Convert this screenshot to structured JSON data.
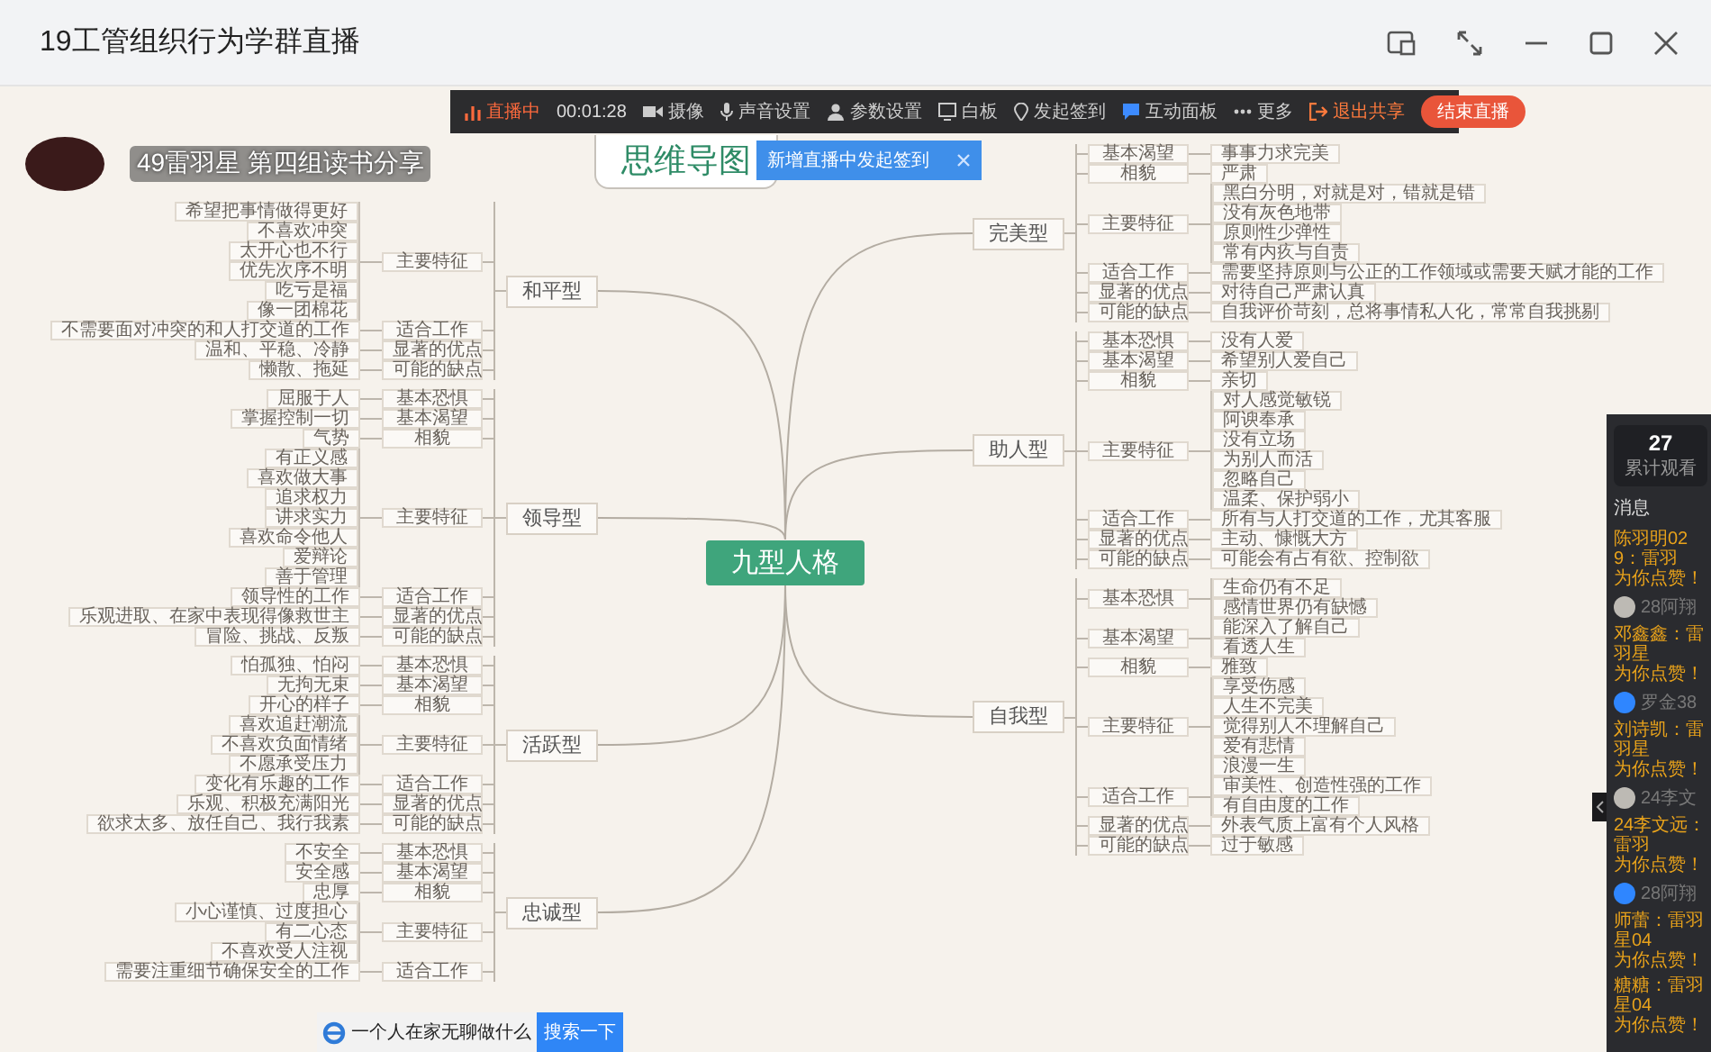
{
  "window": {
    "title": "19工管组织行为学群直播"
  },
  "presenter": {
    "name": "49雷羽星 第四组读书分享"
  },
  "toolbar": {
    "items": [
      {
        "kind": "status",
        "label": "直播中"
      },
      {
        "kind": "timer",
        "label": "00:01:28"
      },
      {
        "kind": "tool",
        "label": "摄像"
      },
      {
        "kind": "tool",
        "label": "声音设置"
      },
      {
        "kind": "tool",
        "label": "参数设置"
      },
      {
        "kind": "tool",
        "label": "白板"
      },
      {
        "kind": "tool",
        "label": "发起签到"
      },
      {
        "kind": "tool",
        "label": "互动面板"
      },
      {
        "kind": "tool",
        "label": "更多"
      },
      {
        "kind": "exit",
        "label": "退出共享"
      },
      {
        "kind": "end",
        "label": "结束直播"
      }
    ]
  },
  "notice": {
    "text": "新增直播中发起签到"
  },
  "mindmap": {
    "title": "思维导图",
    "root": "九型人格",
    "left": [
      {
        "label": "和平型",
        "children": [
          {
            "label": "主要特征",
            "children": [
              {
                "label": "希望把事情做得更好"
              },
              {
                "label": "不喜欢冲突"
              },
              {
                "label": "太开心也不行"
              },
              {
                "label": "优先次序不明"
              },
              {
                "label": "吃亏是福"
              },
              {
                "label": "像一团棉花"
              }
            ]
          },
          {
            "label": "适合工作",
            "children": [
              {
                "label": "不需要面对冲突的和人打交道的工作"
              }
            ]
          },
          {
            "label": "显著的优点",
            "children": [
              {
                "label": "温和、平稳、冷静"
              }
            ]
          },
          {
            "label": "可能的缺点",
            "children": [
              {
                "label": "懒散、拖延"
              }
            ]
          }
        ]
      },
      {
        "label": "领导型",
        "children": [
          {
            "label": "基本恐惧",
            "children": [
              {
                "label": "屈服于人"
              }
            ]
          },
          {
            "label": "基本渴望",
            "children": [
              {
                "label": "掌握控制一切"
              }
            ]
          },
          {
            "label": "相貌",
            "children": [
              {
                "label": "气势"
              }
            ]
          },
          {
            "label": "主要特征",
            "children": [
              {
                "label": "有正义感"
              },
              {
                "label": "喜欢做大事"
              },
              {
                "label": "追求权力"
              },
              {
                "label": "讲求实力"
              },
              {
                "label": "喜欢命令他人"
              },
              {
                "label": "爱辩论"
              },
              {
                "label": "善于管理"
              }
            ]
          },
          {
            "label": "适合工作",
            "children": [
              {
                "label": "领导性的工作"
              }
            ]
          },
          {
            "label": "显著的优点",
            "children": [
              {
                "label": "乐观进取、在家中表现得像救世主"
              }
            ]
          },
          {
            "label": "可能的缺点",
            "children": [
              {
                "label": "冒险、挑战、反叛"
              }
            ]
          }
        ]
      },
      {
        "label": "活跃型",
        "children": [
          {
            "label": "基本恐惧",
            "children": [
              {
                "label": "怕孤独、怕闷"
              }
            ]
          },
          {
            "label": "基本渴望",
            "children": [
              {
                "label": "无拘无束"
              }
            ]
          },
          {
            "label": "相貌",
            "children": [
              {
                "label": "开心的样子"
              }
            ]
          },
          {
            "label": "主要特征",
            "children": [
              {
                "label": "喜欢追赶潮流"
              },
              {
                "label": "不喜欢负面情绪"
              },
              {
                "label": "不愿承受压力"
              }
            ]
          },
          {
            "label": "适合工作",
            "children": [
              {
                "label": "变化有乐趣的工作"
              }
            ]
          },
          {
            "label": "显著的优点",
            "children": [
              {
                "label": "乐观、积极充满阳光"
              }
            ]
          },
          {
            "label": "可能的缺点",
            "children": [
              {
                "label": "欲求太多、放任自己、我行我素"
              }
            ]
          }
        ]
      },
      {
        "label": "忠诚型",
        "children": [
          {
            "label": "基本恐惧",
            "children": [
              {
                "label": "不安全"
              }
            ]
          },
          {
            "label": "基本渴望",
            "children": [
              {
                "label": "安全感"
              }
            ]
          },
          {
            "label": "相貌",
            "children": [
              {
                "label": "忠厚"
              }
            ]
          },
          {
            "label": "主要特征",
            "children": [
              {
                "label": "小心谨慎、过度担心"
              },
              {
                "label": "有二心态"
              },
              {
                "label": "不喜欢受人注视"
              }
            ]
          },
          {
            "label": "适合工作",
            "children": [
              {
                "label": "需要注重细节确保安全的工作"
              }
            ]
          }
        ]
      }
    ],
    "right": [
      {
        "label": "完美型",
        "children": [
          {
            "label": "基本渴望",
            "children": [
              {
                "label": "事事力求完美"
              }
            ]
          },
          {
            "label": "相貌",
            "children": [
              {
                "label": "严肃"
              }
            ]
          },
          {
            "label": "主要特征",
            "children": [
              {
                "label": "黑白分明，对就是对，错就是错"
              },
              {
                "label": "没有灰色地带"
              },
              {
                "label": "原则性少弹性"
              },
              {
                "label": "常有内疚与自责"
              }
            ]
          },
          {
            "label": "适合工作",
            "children": [
              {
                "label": "需要坚持原则与公正的工作领域或需要天赋才能的工作"
              }
            ]
          },
          {
            "label": "显著的优点",
            "children": [
              {
                "label": "对待自己严肃认真"
              }
            ]
          },
          {
            "label": "可能的缺点",
            "children": [
              {
                "label": "自我评价苛刻，总将事情私人化，常常自我挑剔"
              }
            ]
          }
        ]
      },
      {
        "label": "助人型",
        "children": [
          {
            "label": "基本恐惧",
            "children": [
              {
                "label": "没有人爱"
              }
            ]
          },
          {
            "label": "基本渴望",
            "children": [
              {
                "label": "希望别人爱自己"
              }
            ]
          },
          {
            "label": "相貌",
            "children": [
              {
                "label": "亲切"
              }
            ]
          },
          {
            "label": "主要特征",
            "children": [
              {
                "label": "对人感觉敏锐"
              },
              {
                "label": "阿谀奉承"
              },
              {
                "label": "没有立场"
              },
              {
                "label": "为别人而活"
              },
              {
                "label": "忽略自己"
              },
              {
                "label": "温柔、保护弱小"
              }
            ]
          },
          {
            "label": "适合工作",
            "children": [
              {
                "label": "所有与人打交道的工作，尤其客服"
              }
            ]
          },
          {
            "label": "显著的优点",
            "children": [
              {
                "label": "主动、慷慨大方"
              }
            ]
          },
          {
            "label": "可能的缺点",
            "children": [
              {
                "label": "可能会有占有欲、控制欲"
              }
            ]
          }
        ]
      },
      {
        "label": "自我型",
        "children": [
          {
            "label": "基本恐惧",
            "children": [
              {
                "label": "生命仍有不足"
              },
              {
                "label": "感情世界仍有缺憾"
              }
            ]
          },
          {
            "label": "基本渴望",
            "children": [
              {
                "label": "能深入了解自己"
              },
              {
                "label": "看透人生"
              }
            ]
          },
          {
            "label": "相貌",
            "children": [
              {
                "label": "雅致"
              }
            ]
          },
          {
            "label": "主要特征",
            "children": [
              {
                "label": "享受伤感"
              },
              {
                "label": "人生不完美"
              },
              {
                "label": "觉得别人不理解自己"
              },
              {
                "label": "爱有悲情"
              },
              {
                "label": "浪漫一生"
              }
            ]
          },
          {
            "label": "适合工作",
            "children": [
              {
                "label": "审美性、创造性强的工作"
              },
              {
                "label": "有自由度的工作"
              }
            ]
          },
          {
            "label": "显著的优点",
            "children": [
              {
                "label": "外表气质上富有个人风格"
              }
            ]
          },
          {
            "label": "可能的缺点",
            "children": [
              {
                "label": "过于敏感"
              }
            ]
          }
        ]
      }
    ]
  },
  "chat": {
    "viewers": "27",
    "viewers_label": "累计观看",
    "heading": "消息",
    "items": [
      {
        "kind": "message",
        "text": "陈羽明029：雷羽",
        "tail": "为你点赞！"
      },
      {
        "kind": "join",
        "text": "28阿翔"
      },
      {
        "kind": "message",
        "text": "邓鑫鑫：雷羽星",
        "tail": "为你点赞！"
      },
      {
        "kind": "member",
        "text": "罗金38"
      },
      {
        "kind": "message",
        "text": "刘诗凯：雷羽星",
        "tail": "为你点赞！"
      },
      {
        "kind": "join",
        "text": "24李文"
      },
      {
        "kind": "message",
        "text": "24李文远：雷羽",
        "tail": "为你点赞！"
      },
      {
        "kind": "member",
        "text": "28阿翔"
      },
      {
        "kind": "message",
        "text": "师蕾：雷羽星04",
        "tail": "为你点赞！"
      },
      {
        "kind": "message",
        "text": "糖糖：雷羽星04",
        "tail": "为你点赞！"
      }
    ]
  },
  "search": {
    "value": "一个人在家无聊做什么",
    "button": "搜索一下"
  }
}
